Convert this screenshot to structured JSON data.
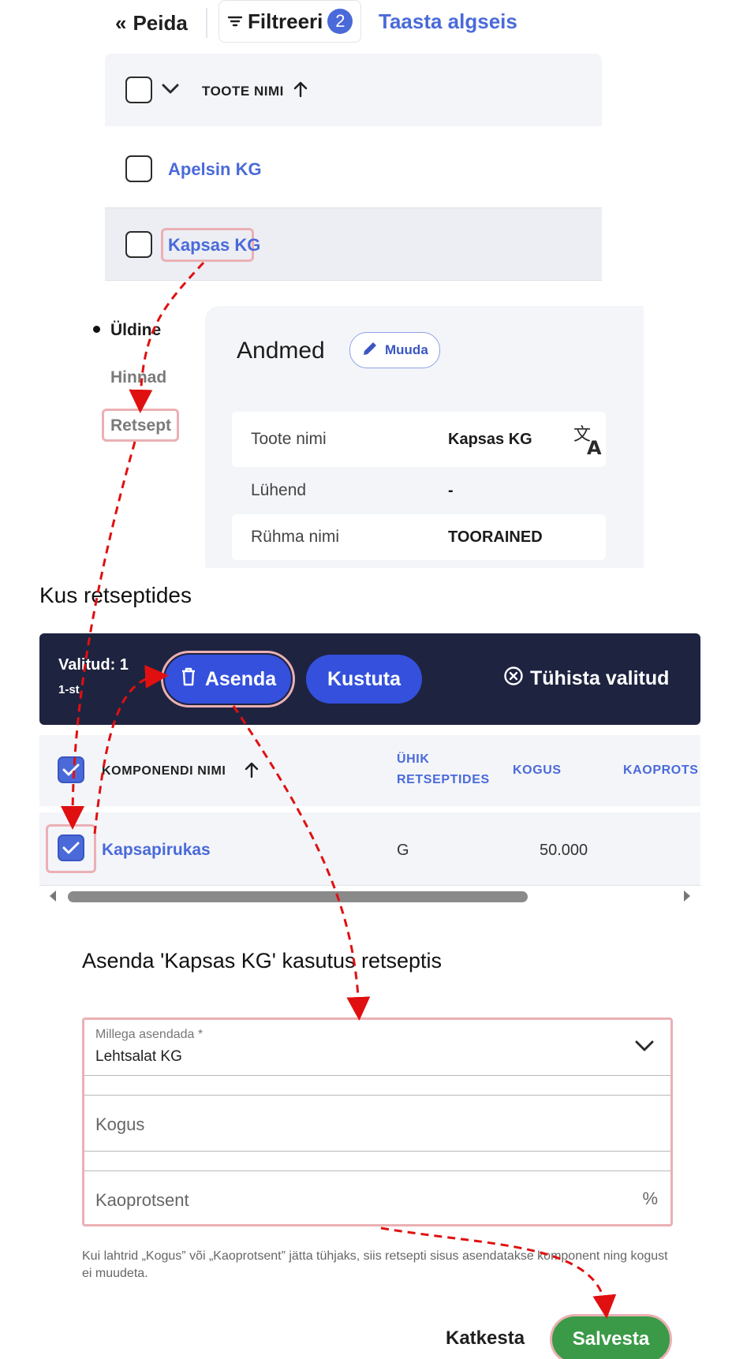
{
  "toolbar": {
    "hide_label": "Peida",
    "filter_label": "Filtreeri",
    "filter_count": "2",
    "reset_label": "Taasta algseis"
  },
  "product_list": {
    "column_header": "TOOTE NIMI",
    "rows": [
      {
        "name": "Apelsin KG"
      },
      {
        "name": "Kapsas KG"
      }
    ]
  },
  "side_menu": {
    "items": [
      {
        "label": "Üldine",
        "active": true
      },
      {
        "label": "Hinnad"
      },
      {
        "label": "Retsept"
      }
    ]
  },
  "details": {
    "title": "Andmed",
    "edit_label": "Muuda",
    "fields": [
      {
        "label": "Toote nimi",
        "value": "Kapsas KG"
      },
      {
        "label": "Lühend",
        "value": "-"
      },
      {
        "label": "Rühma nimi",
        "value": "TOORAINED"
      }
    ]
  },
  "recipes": {
    "title": "Kus retseptides",
    "selected_label": "Valitud: 1",
    "selected_sub": "1-st",
    "replace_label": "Asenda",
    "delete_label": "Kustuta",
    "clear_label": "Tühista valitud",
    "columns": {
      "name": "KOMPONENDI NIMI",
      "unit_line1": "ÜHIK",
      "unit_line2": "RETSEPTIDES",
      "amount": "KOGUS",
      "loss": "KAOPROTS"
    },
    "rows": [
      {
        "name": "Kapsapirukas",
        "unit": "G",
        "amount": "50.000",
        "checked": true
      }
    ]
  },
  "replace_form": {
    "title": "Asenda 'Kapsas KG' kasutus retseptis",
    "replace_with_label": "Millega asendada *",
    "replace_with_value": "Lehtsalat KG",
    "amount_placeholder": "Kogus",
    "loss_placeholder": "Kaoprotsent",
    "loss_suffix": "%",
    "help_text": "Kui lahtrid „Kogus” või „Kaoprotsent” jätta tühjaks, siis retsepti sisus asendatakse komponent ning kogust ei muudeta.",
    "cancel_label": "Katkesta",
    "save_label": "Salvesta"
  },
  "colors": {
    "accent": "#4a6ad9",
    "action_bar": "#1e2340",
    "save": "#3b9a47",
    "highlight": "#ebb0b4",
    "arrow": "#e01010"
  }
}
